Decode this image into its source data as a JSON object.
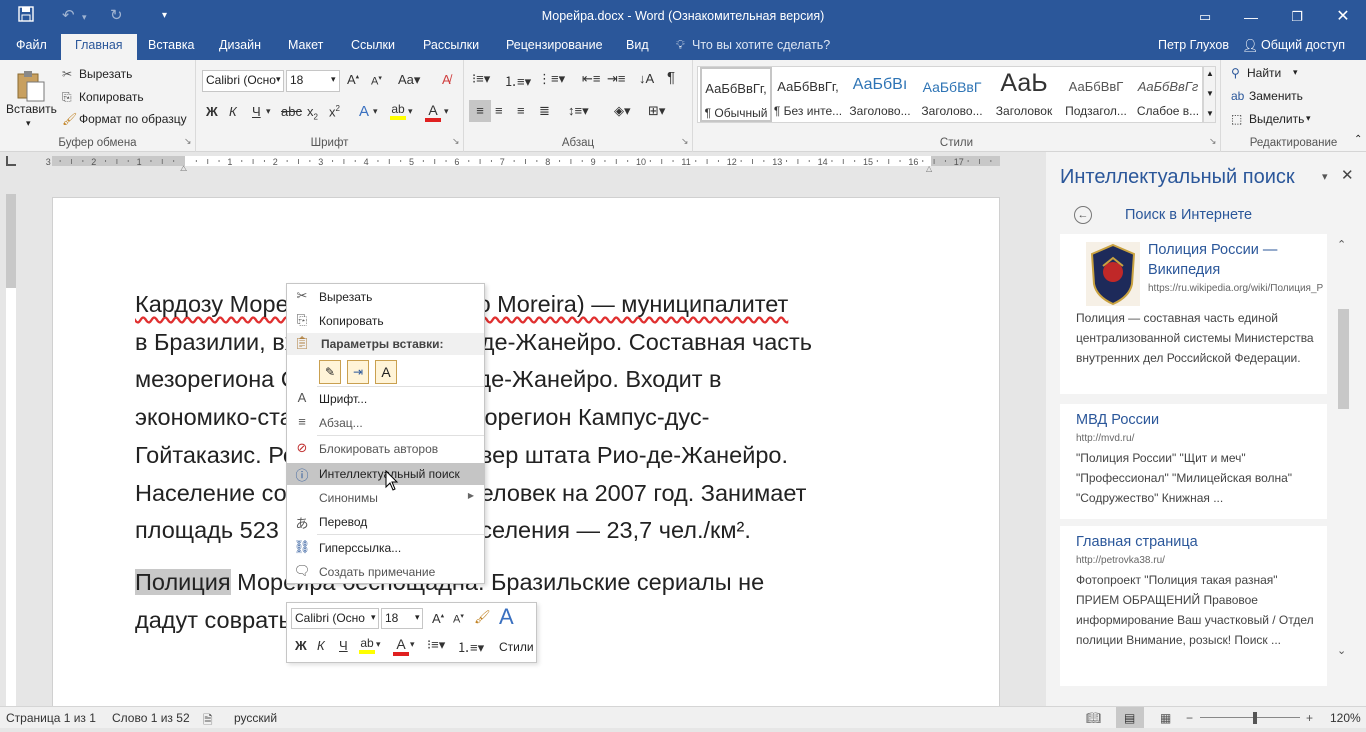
{
  "window": {
    "title": "Морейра.docx - Word (Ознакомительная версия)"
  },
  "tabs": {
    "file": "Файл",
    "home": "Главная",
    "insert": "Вставка",
    "design": "Дизайн",
    "layout": "Макет",
    "references": "Ссылки",
    "mailings": "Рассылки",
    "review": "Рецензирование",
    "view": "Вид",
    "tellme": "Что вы хотите сделать?",
    "user": "Петр Глухов",
    "share": "Общий доступ"
  },
  "clipboard": {
    "paste": "Вставить",
    "cut": "Вырезать",
    "copy": "Копировать",
    "format_painter": "Формат по образцу",
    "label": "Буфер обмена"
  },
  "font": {
    "name": "Calibri (Осно",
    "size": "18",
    "bold": "Ж",
    "italic": "К",
    "underline": "Ч",
    "label": "Шрифт"
  },
  "paragraph": {
    "label": "Абзац"
  },
  "styles": {
    "label": "Стили",
    "items": [
      {
        "preview": "АаБбВвГг,",
        "name": "¶ Обычный"
      },
      {
        "preview": "АаБбВвГг,",
        "name": "¶ Без инте..."
      },
      {
        "preview": "АаБбВı",
        "name": "Заголово..."
      },
      {
        "preview": "АаБбВвГ",
        "name": "Заголово..."
      },
      {
        "preview": "АаЬ",
        "name": "Заголовок"
      },
      {
        "preview": "АаБбВвГ",
        "name": "Подзагол..."
      },
      {
        "preview": "АаБбВвГг",
        "name": "Слабое в..."
      }
    ]
  },
  "editing": {
    "find": "Найти",
    "replace": "Заменить",
    "select": "Выделить",
    "label": "Редактирование"
  },
  "document": {
    "lines": [
      "Кардозу Морейра (порт. Cardoso Moreira) — муниципалитет",
      "в Бразилии, входит в штат Рио-де-Жанейро. Составная часть",
      "мезорегиона Север штата Рио-де-Жанейро. Входит в",
      "экономико-статистический микрорегион Кампус-дус-",
      "Гойтаказис. Регион входит в Север штата Рио-де-Жанейро.",
      "Население составляет 12 206 человек на 2007 год. Занимает",
      "площадь 523 км². Плотность населения — 23,7 чел./км²."
    ],
    "p2_selected": "Полиция",
    "p2_rest": " Морейра беспощадна. Бразильские сериалы не",
    "p2_line2": "дадут соврать."
  },
  "context_menu": {
    "cut": "Вырезать",
    "copy": "Копировать",
    "paste_options": "Параметры вставки:",
    "font": "Шрифт...",
    "paragraph": "Абзац...",
    "block_authors": "Блокировать авторов",
    "smart_lookup": "Интеллектуальный поиск",
    "synonyms": "Синонимы",
    "translate": "Перевод",
    "hyperlink": "Гиперссылка...",
    "comment": "Создать примечание"
  },
  "minibar": {
    "font": "Calibri (Осно",
    "size": "18",
    "styles": "Стили",
    "bold": "Ж",
    "italic": "К",
    "underline": "Ч"
  },
  "smart_lookup": {
    "title": "Интеллектуальный поиск",
    "search_web": "Поиск в Интернете",
    "results": [
      {
        "title": "Полиция России — Википедия",
        "url": "https://ru.wikipedia.org/wiki/Полиция_Р",
        "desc": "Полиция — составная часть единой централизованной системы Министерства внутренних дел Российской Федерации."
      },
      {
        "title": "МВД России",
        "url": "http://mvd.ru/",
        "desc": "\"Полиция России\" \"Щит и меч\" \"Профессионал\" \"Милицейская волна\" \"Содружество\" Книжная ..."
      },
      {
        "title": "Главная страница",
        "url": "http://petrovka38.ru/",
        "desc": "Фотопроект \"Полиция такая разная\" ПРИЕМ ОБРАЩЕНИЙ Правовое информирование Ваш участковый / Отдел полиции Внимание, розыск! Поиск ..."
      }
    ]
  },
  "status": {
    "page": "Страница 1 из 1",
    "words": "Слово 1 из 52",
    "language": "русский",
    "zoom": "120%"
  },
  "colors": {
    "brand": "#2b579a",
    "highlight": "#ffff00",
    "font_color": "#e02020"
  }
}
